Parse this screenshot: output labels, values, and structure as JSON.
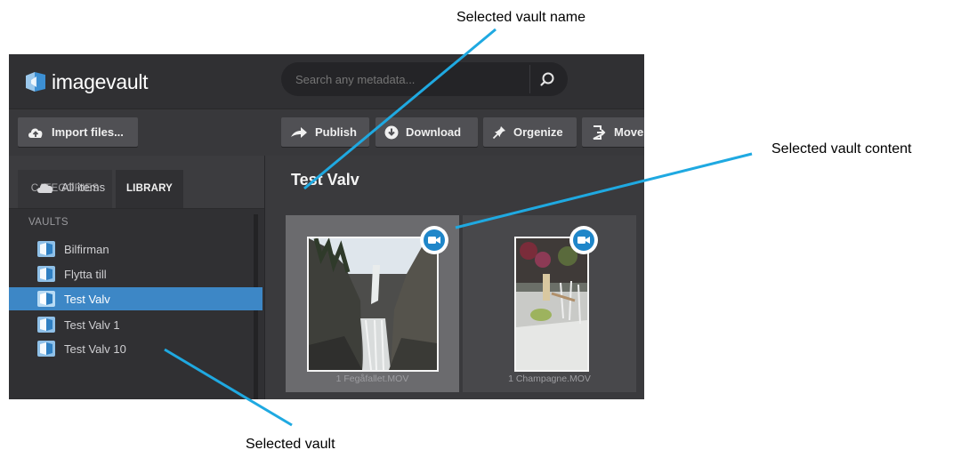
{
  "app": {
    "logo_text": "imagevault",
    "search": {
      "placeholder": "Search any metadata..."
    },
    "toolbar": {
      "import": "Import files...",
      "publish": "Publish",
      "download": "Download",
      "organize": "Orgenize",
      "move": "Move"
    },
    "sidebar": {
      "tabs": [
        "CATEGORIES",
        "LIBRARY"
      ],
      "active_tab": "LIBRARY",
      "all_items": "All items",
      "vaults_heading": "VAULTS",
      "vaults": [
        "Bilfirman",
        "Flytta till",
        "Test Valv",
        "Test Valv 1",
        "Test Valv 10"
      ],
      "selected_vault": "Test Valv"
    },
    "main": {
      "title": "Test Valv",
      "items": [
        {
          "name": "1 Fegåfallet.MOV",
          "type": "video-icon",
          "selected": true
        },
        {
          "name": "1 Champagne.MOV",
          "type": "video-icon",
          "selected": false
        }
      ]
    },
    "accent_color": "#3d87c6",
    "badge_color": "#1f86c9"
  },
  "annotations": {
    "vault_name": "Selected vault name",
    "vault_content": "Selected vault content",
    "vault": "Selected vault",
    "line_color": "#1fa9e1"
  }
}
